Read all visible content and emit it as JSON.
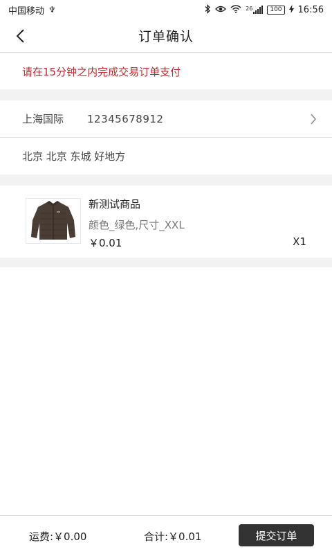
{
  "status_bar": {
    "carrier": "中国移动",
    "usb_glyph": "♆",
    "network": "26",
    "battery": "100",
    "time": "16:56"
  },
  "nav": {
    "title": "订单确认"
  },
  "notice": {
    "text": "请在15分钟之内完成交易订单支付"
  },
  "address": {
    "name": "上海国际",
    "phone": "12345678912",
    "detail": "北京 北京 东城 好地方"
  },
  "product": {
    "name": "新测试商品",
    "spec": "颜色_绿色,尺寸_XXL",
    "price": "￥0.01",
    "quantity": "X1"
  },
  "footer": {
    "shipping": "运费:￥0.00",
    "total": "合计:￥0.01",
    "submit_label": "提交订单"
  },
  "colors": {
    "notice_red": "#c0272d",
    "button_dark": "#333333",
    "separator_gray": "#f2f2f2"
  },
  "icons": {
    "back": "arrow-left-icon",
    "chevron": "chevron-right-icon",
    "bluetooth": "bluetooth-icon",
    "eye": "eye-icon",
    "wifi": "wifi-icon",
    "signal": "signal-icon",
    "charging": "charging-icon"
  }
}
